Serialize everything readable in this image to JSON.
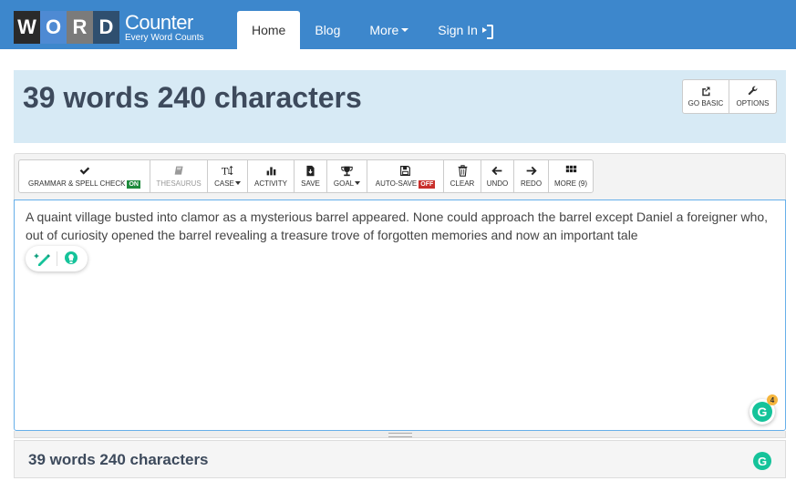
{
  "logo": {
    "letters": [
      "W",
      "O",
      "R",
      "D"
    ],
    "title": "Counter",
    "tagline": "Every Word Counts"
  },
  "nav": {
    "home": "Home",
    "blog": "Blog",
    "more": "More",
    "signin": "Sign In"
  },
  "stats": {
    "headline": "39 words 240 characters"
  },
  "side_buttons": {
    "go_basic": "GO BASIC",
    "options": "OPTIONS"
  },
  "toolbar": {
    "grammar": "GRAMMAR & SPELL CHECK",
    "grammar_badge": "ON",
    "thesaurus": "THESAURUS",
    "case": "CASE",
    "activity": "ACTIVITY",
    "save": "SAVE",
    "goal": "GOAL",
    "autosave": "AUTO-SAVE",
    "autosave_badge": "OFF",
    "clear": "CLEAR",
    "undo": "UNDO",
    "redo": "REDO",
    "more": "MORE (9)"
  },
  "editor": {
    "text": "A quaint village busted into clamor as a mysterious barrel appeared. None could approach the barrel except Daniel a foreigner who, out of curiosity opened the barrel revealing a treasure trove of forgotten memories and now an important tale"
  },
  "grammarly": {
    "count": "4",
    "letter": "G"
  },
  "footer": {
    "headline": "39 words 240 characters"
  },
  "colors": {
    "navbar": "#3d87cc",
    "stats_panel": "#d7eaf5",
    "headline_text": "#3d4a5c",
    "badge_on": "#1e8a3c",
    "badge_off": "#c9302c",
    "grammarly": "#15c39a"
  },
  "icons": {
    "go_basic": "external-link-icon",
    "options": "wrench-icon",
    "grammar": "checkmark-icon",
    "thesaurus": "book-icon",
    "case": "text-height-icon",
    "activity": "bar-chart-icon",
    "save": "file-download-icon",
    "goal": "trophy-icon",
    "autosave": "floppy-disk-icon",
    "clear": "trash-icon",
    "undo": "arrow-left-icon",
    "redo": "arrow-right-icon",
    "more": "grid-icon",
    "signin": "sign-in-icon"
  }
}
